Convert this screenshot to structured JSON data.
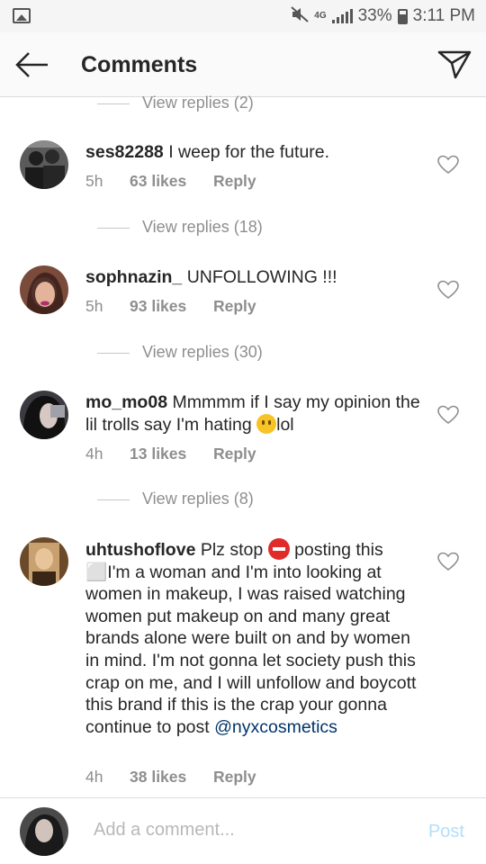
{
  "status_bar": {
    "network": "4G",
    "battery_percent": "33%",
    "time": "3:11 PM",
    "icons": [
      "image-notification-icon",
      "mute-icon",
      "network-4g-icon",
      "signal-icon",
      "battery-icon"
    ]
  },
  "header": {
    "title": "Comments",
    "back_icon": "arrow-left-icon",
    "send_icon": "paper-plane-icon"
  },
  "view_replies": [
    "View replies (2)",
    "View replies (18)",
    "View replies (30)",
    "View replies (8)"
  ],
  "comments": [
    {
      "username": "ses82288",
      "text": "I weep for the future.",
      "time": "5h",
      "likes": "63 likes",
      "reply": "Reply"
    },
    {
      "username": "sophnazin_",
      "text": "UNFOLLOWING !!!",
      "time": "5h",
      "likes": "93 likes",
      "reply": "Reply"
    },
    {
      "username": "mo_mo08",
      "text_before_emoji": "Mmmmm if I say my opinion the lil trolls say I'm hating",
      "text_after_emoji": "lol",
      "emoji": "smirk-face-emoji",
      "time": "4h",
      "likes": "13 likes",
      "reply": "Reply"
    },
    {
      "username": "uhtushoflove",
      "text_before_emoji": "Plz stop",
      "emoji": "no-entry-emoji",
      "text_after_emoji": "posting this ⬜I'm a woman and I'm into looking at women in makeup, I was raised watching women put makeup on and many great brands alone were built on and by women in mind. I'm not gonna let society push this crap on me, and I will unfollow and boycott this brand if this is the crap your gonna continue to post",
      "mention": "@nyxcosmetics",
      "time": "4h",
      "likes": "38 likes",
      "reply": "Reply"
    }
  ],
  "composer": {
    "placeholder": "Add a comment...",
    "post_label": "Post"
  },
  "colors": {
    "header_bg": "#fafafa",
    "text": "#262626",
    "muted": "#8e8e8e",
    "mention": "#003569",
    "post_disabled": "#b2dffc"
  }
}
